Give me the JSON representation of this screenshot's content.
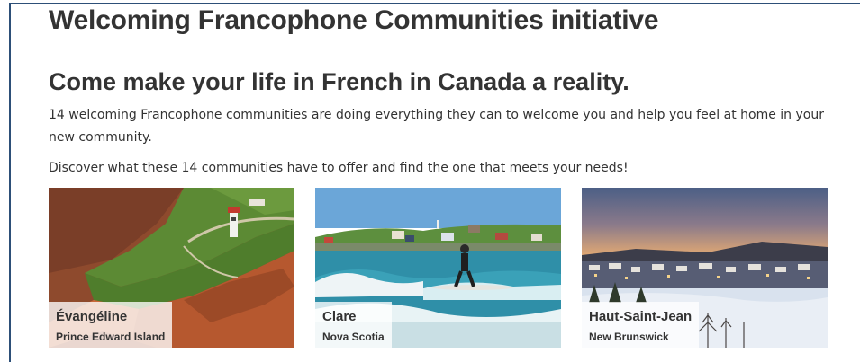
{
  "page": {
    "section_title": "Welcoming Francophone Communities initiative",
    "lead_title": "Come make your life in French in Canada a reality.",
    "intro_text": "14 welcoming Francophone communities are doing everything they can to welcome you and help you feel at home in your new community.",
    "discover_text": "Discover what these 14 communities have to offer and find the one that meets your needs!"
  },
  "communities": [
    {
      "name": "Évangéline",
      "province": "Prince Edward Island"
    },
    {
      "name": "Clare",
      "province": "Nova Scotia"
    },
    {
      "name": "Haut-Saint-Jean",
      "province": "New Brunswick"
    }
  ],
  "colors": {
    "rule": "#af3c43",
    "frame": "#2d4f78",
    "text": "#333333"
  }
}
